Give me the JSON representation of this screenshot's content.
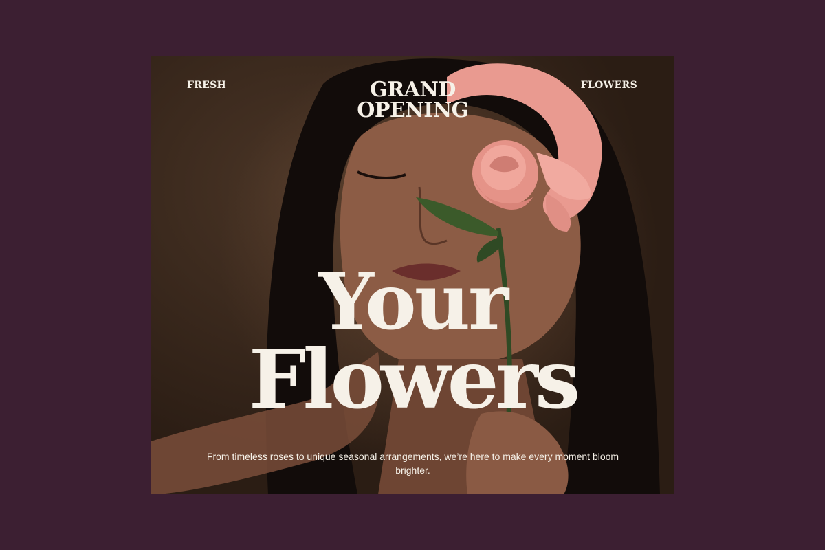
{
  "poster": {
    "left_label": "FRESH",
    "right_label": "FLOWERS",
    "headline_top_line1": "GRAND",
    "headline_top_line2": "OPENING",
    "headline_main_line1": "Your",
    "headline_main_line2": "Flowers",
    "tagline": "From timeless roses to unique seasonal arrangements, we’re here to make every moment bloom brighter."
  },
  "colors": {
    "background": "#3c1f32",
    "text": "#f6f1e8",
    "rose": "#e99a90"
  }
}
